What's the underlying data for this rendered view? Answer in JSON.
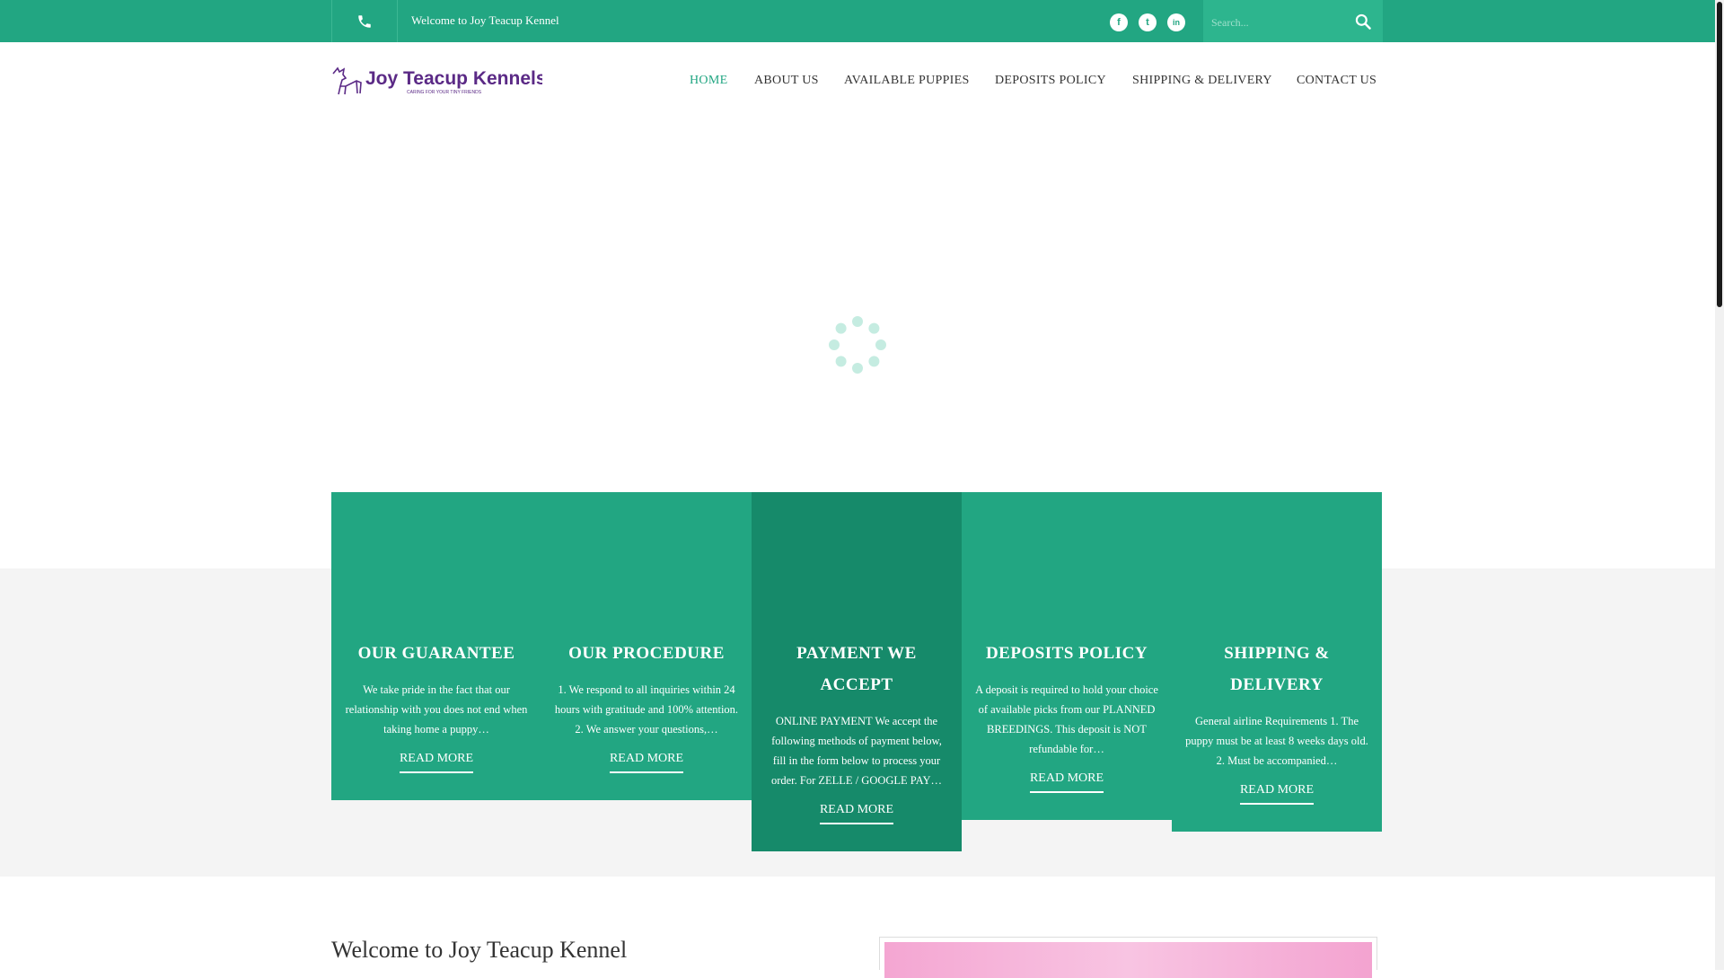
{
  "topbar": {
    "welcome": "Welcome to Joy Teacup Kennel",
    "search_placeholder": "Search...",
    "social": [
      "f",
      "t",
      "in"
    ]
  },
  "logo": {
    "name": "Joy Teacup Kennels",
    "tagline": "CARING FOR YOUR TINY FRIENDS"
  },
  "nav": [
    {
      "label": "HOME",
      "active": true
    },
    {
      "label": "ABOUT US",
      "active": false
    },
    {
      "label": "AVAILABLE PUPPIES",
      "active": false
    },
    {
      "label": "DEPOSITS POLICY",
      "active": false
    },
    {
      "label": "SHIPPING & DELIVERY",
      "active": false
    },
    {
      "label": "CONTACT US",
      "active": false
    }
  ],
  "cards": [
    {
      "title": "OUR GUARANTEE",
      "text": "We take pride in the fact that our relationship with you does not end when taking home a puppy…",
      "more": "READ MORE"
    },
    {
      "title": "OUR PROCEDURE",
      "text": "1.    We respond to all inquiries within 24 hours with gratitude and 100% attention. 2.    We answer your questions,…",
      "more": "READ MORE"
    },
    {
      "title": "PAYMENT WE ACCEPT",
      "text": "ONLINE  PAYMENT  We accept the following methods of payment below, fill in the form below to process your order. For  ZELLE / GOOGLE PAY…",
      "more": "READ MORE"
    },
    {
      "title": "DEPOSITS POLICY",
      "text": "A deposit is required to hold your choice of available picks from our PLANNED BREEDINGS. This deposit is NOT refundable for…",
      "more": "READ MORE"
    },
    {
      "title": "SHIPPING & DELIVERY",
      "text": "General airline Requirements  1. The puppy must be at least 8 weeks days old. 2. Must be accompanied…",
      "more": "READ MORE"
    }
  ],
  "welcome_section": {
    "title": "Welcome to Joy Teacup Kennel"
  },
  "colors": {
    "accent": "#22a682",
    "accent_dark": "#168a6a",
    "logo_purple": "#5b2a86"
  }
}
